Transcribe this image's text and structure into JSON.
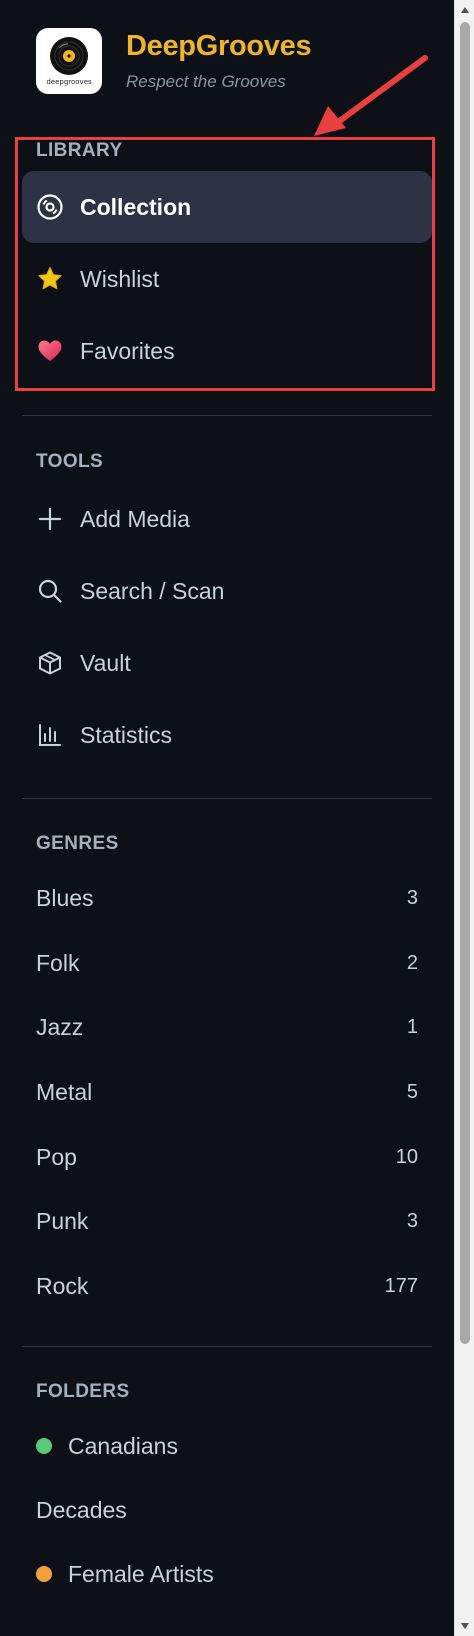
{
  "app": {
    "title": "DeepGrooves",
    "tagline": "Respect the Grooves",
    "logo_text": "deepgrooves",
    "brand_color": "#f0b429"
  },
  "library": {
    "title": "LIBRARY",
    "items": [
      {
        "label": "Collection",
        "icon": "vinyl-disc-icon",
        "active": true
      },
      {
        "label": "Wishlist",
        "icon": "star-icon",
        "active": false
      },
      {
        "label": "Favorites",
        "icon": "heart-icon",
        "active": false
      }
    ]
  },
  "tools": {
    "title": "TOOLS",
    "items": [
      {
        "label": "Add Media",
        "icon": "plus-icon"
      },
      {
        "label": "Search / Scan",
        "icon": "search-icon"
      },
      {
        "label": "Vault",
        "icon": "box-icon"
      },
      {
        "label": "Statistics",
        "icon": "bar-chart-icon"
      }
    ]
  },
  "genres": {
    "title": "GENRES",
    "items": [
      {
        "label": "Blues",
        "count": "3"
      },
      {
        "label": "Folk",
        "count": "2"
      },
      {
        "label": "Jazz",
        "count": "1"
      },
      {
        "label": "Metal",
        "count": "5"
      },
      {
        "label": "Pop",
        "count": "10"
      },
      {
        "label": "Punk",
        "count": "3"
      },
      {
        "label": "Rock",
        "count": "177"
      }
    ]
  },
  "folders": {
    "title": "FOLDERS",
    "items": [
      {
        "label": "Canadians",
        "dot_color": "#5cc97a"
      },
      {
        "label": "Decades",
        "dot_color": ""
      },
      {
        "label": "Female Artists",
        "dot_color": "#f0a03c"
      }
    ]
  },
  "annotation": {
    "color": "#e8403f"
  }
}
